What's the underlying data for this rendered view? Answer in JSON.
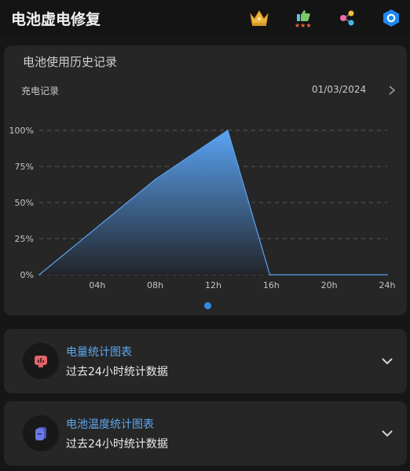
{
  "app": {
    "title": "电池虚电修复"
  },
  "toolbar": {
    "icons": [
      "crown-icon",
      "thumbs-up-rating-icon",
      "share-icon",
      "settings-hexagon-icon"
    ]
  },
  "history": {
    "title": "电池使用历史记录",
    "sub_label": "充电记录",
    "date": "01/03/2024"
  },
  "chart_data": {
    "type": "area",
    "x_ticks": [
      "04h",
      "08h",
      "12h",
      "16h",
      "20h",
      "24h"
    ],
    "y_ticks": [
      "0%",
      "25%",
      "50%",
      "75%",
      "100%"
    ],
    "xlim": [
      0,
      24
    ],
    "ylim": [
      0,
      100
    ],
    "grid": true,
    "points": [
      {
        "x": 0,
        "y": 0
      },
      {
        "x": 8,
        "y": 66
      },
      {
        "x": 13,
        "y": 100
      },
      {
        "x": 15.9,
        "y": 0
      },
      {
        "x": 24,
        "y": 0
      }
    ],
    "colors": {
      "fill_top": "#5aa3f3",
      "fill_bottom": "#22252a",
      "grid": "#555555",
      "tick": "#c4c4c4"
    }
  },
  "pager": {
    "active_color": "#2f8de6"
  },
  "cards": [
    {
      "title": "电量统计图表",
      "subtitle": "过去24小时统计数据",
      "icon": "battery-stat-icon",
      "icon_color": "#e0646c"
    },
    {
      "title": "电池温度统计图表",
      "subtitle": "过去24小时统计数据",
      "icon": "temperature-stat-icon",
      "icon_color": "#6c78e6"
    }
  ]
}
